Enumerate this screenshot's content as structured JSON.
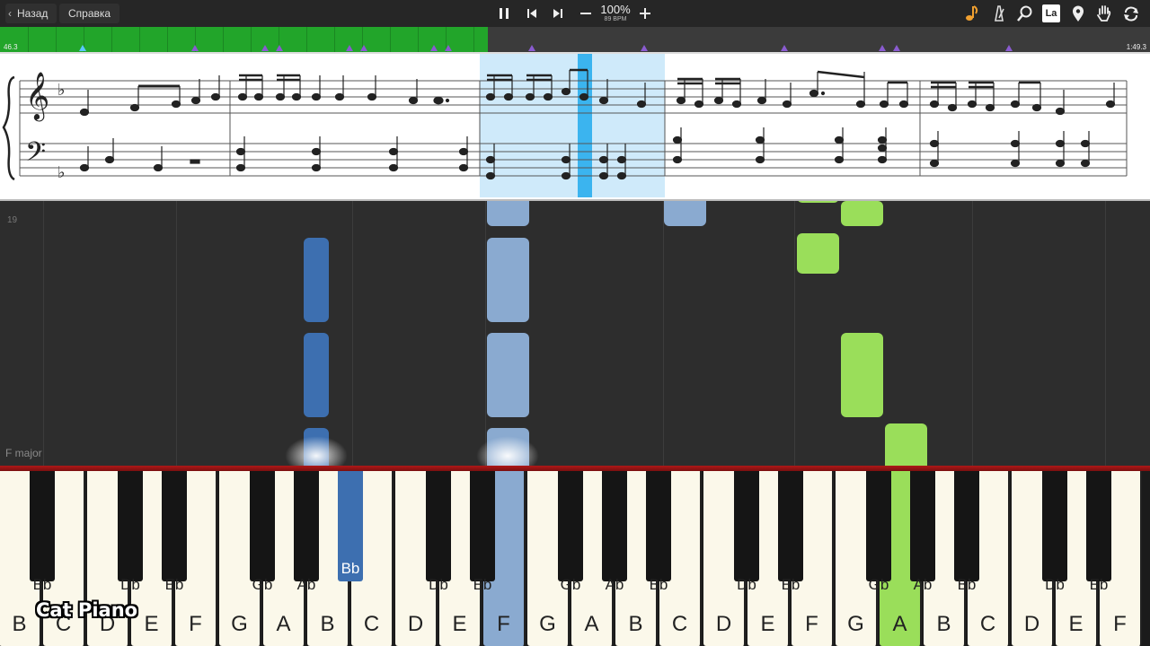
{
  "nav": {
    "back_label": "Назад",
    "help_label": "Справка"
  },
  "transport": {
    "pause_icon": "pause-icon",
    "prev_icon": "skip-back-icon",
    "next_icon": "skip-forward-icon",
    "zoom_out_icon": "minus-icon",
    "zoom_in_icon": "plus-icon",
    "tempo_percent": "100%",
    "tempo_bpm": "89 BPM"
  },
  "tools": {
    "items": [
      "note-icon",
      "metronome-icon",
      "search-icon",
      "language-icon",
      "marker-icon",
      "hand-icon",
      "loop-icon"
    ],
    "language_label": "La",
    "accent_color": "#f0a030"
  },
  "timeline": {
    "start_time": "46.3",
    "end_time": "1:49.3",
    "progress": 0.424,
    "played_color": "#22a52a",
    "marker_color": "#8a5bd0"
  },
  "roll": {
    "bar_number": "19",
    "key_signature": "F major"
  },
  "keyboard": {
    "white_keys": [
      "B",
      "C",
      "D",
      "E",
      "F",
      "G",
      "A",
      "B",
      "C",
      "D",
      "E",
      "F",
      "G",
      "A",
      "B",
      "C",
      "D",
      "E",
      "F",
      "G",
      "A",
      "B",
      "C",
      "D",
      "E",
      "F"
    ],
    "black_keys": [
      "Bb",
      "Db",
      "Eb",
      "Gb",
      "Ab",
      "Bb",
      "Db",
      "Eb",
      "Gb",
      "Ab",
      "Bb",
      "Db",
      "Eb",
      "Gb",
      "Ab",
      "Bb",
      "Db",
      "Eb",
      "Gb"
    ],
    "pressed_left_hand": "F",
    "pressed_left_hand_black": "Bb",
    "pressed_right_hand": "A",
    "left_hand_color": "#8aaad0",
    "left_hand_dark_color": "#3d6fb0",
    "right_hand_color": "#9ade5a"
  },
  "watermark": "Cat Piano"
}
